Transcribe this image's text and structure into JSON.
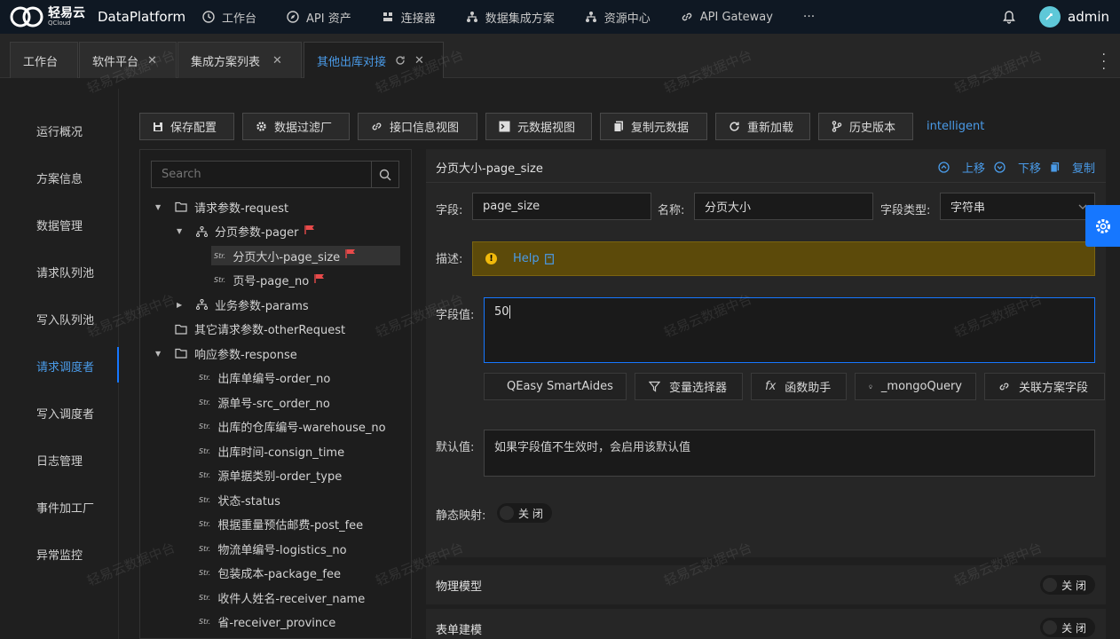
{
  "topnav": {
    "logo_cn": "轻易云",
    "logo_en": "QCloud",
    "app_name": "DataPlatform",
    "items": [
      {
        "label": "工作台",
        "icon": "clock-icon"
      },
      {
        "label": "API 资产",
        "icon": "compass-icon"
      },
      {
        "label": "连接器",
        "icon": "connector-icon"
      },
      {
        "label": "数据集成方案",
        "icon": "sitemap-icon"
      },
      {
        "label": "资源中心",
        "icon": "sitemap-icon"
      },
      {
        "label": "API Gateway",
        "icon": "link-icon"
      }
    ],
    "more": "···",
    "username": "admin"
  },
  "tabs": [
    {
      "label": "工作台"
    },
    {
      "label": "软件平台"
    },
    {
      "label": "集成方案列表"
    },
    {
      "label": "其他出库对接"
    }
  ],
  "sidebar": {
    "items": [
      "运行概况",
      "方案信息",
      "数据管理",
      "请求队列池",
      "写入队列池",
      "请求调度者",
      "写入调度者",
      "日志管理",
      "事件加工厂",
      "异常监控"
    ],
    "active_index": 5
  },
  "toolbar": {
    "buttons": [
      "保存配置",
      "数据过滤厂",
      "接口信息视图",
      "元数据视图",
      "复制元数据",
      "重新加载",
      "历史版本"
    ],
    "link": "intelligent"
  },
  "tree": {
    "search_placeholder": "Search",
    "nodes": [
      {
        "label": "请求参数-request",
        "type": "folder",
        "expanded": true
      },
      {
        "label": "分页参数-pager",
        "type": "object",
        "expanded": true,
        "flag": true
      },
      {
        "label": "分页大小-page_size",
        "type": "string",
        "flag": true,
        "selected": true
      },
      {
        "label": "页号-page_no",
        "type": "string",
        "flag": true
      },
      {
        "label": "业务参数-params",
        "type": "object",
        "expanded": false
      },
      {
        "label": "其它请求参数-otherRequest",
        "type": "folder"
      },
      {
        "label": "响应参数-response",
        "type": "folder",
        "expanded": true
      },
      {
        "label": "出库单编号-order_no",
        "type": "string"
      },
      {
        "label": "源单号-src_order_no",
        "type": "string"
      },
      {
        "label": "出库的仓库编号-warehouse_no",
        "type": "string"
      },
      {
        "label": "出库时间-consign_time",
        "type": "string"
      },
      {
        "label": "源单据类别-order_type",
        "type": "string"
      },
      {
        "label": "状态-status",
        "type": "string"
      },
      {
        "label": "根据重量预估邮费-post_fee",
        "type": "string"
      },
      {
        "label": "物流单编号-logistics_no",
        "type": "string"
      },
      {
        "label": "包装成本-package_fee",
        "type": "string"
      },
      {
        "label": "收件人姓名-receiver_name",
        "type": "string"
      },
      {
        "label": "省-receiver_province",
        "type": "string"
      }
    ],
    "string_tag": "Str."
  },
  "form": {
    "title": "分页大小-page_size",
    "actions": {
      "up": "上移",
      "down": "下移",
      "copy": "复制"
    },
    "field_label": "字段:",
    "field_value": "page_size",
    "name_label": "名称:",
    "name_value": "分页大小",
    "type_label": "字段类型:",
    "type_value": "字符串",
    "desc_label": "描述:",
    "help": "Help",
    "value_label": "字段值:",
    "value": "50",
    "aides": [
      "QEasy SmartAides",
      "变量选择器",
      "函数助手",
      "_mongoQuery",
      "关联方案字段"
    ],
    "fx": "fx",
    "default_label": "默认值:",
    "default_placeholder": "如果字段值不生效时，会启用该默认值",
    "static_label": "静态映射:",
    "static_toggle": "关 闭"
  },
  "sections": [
    {
      "title": "物理模型",
      "toggle": "关 闭"
    },
    {
      "title": "表单建模",
      "toggle": "关 闭"
    }
  ],
  "watermark": "轻易云数据中台",
  "colors": {
    "accent": "#1677ff",
    "link": "#4a9be8",
    "topbar": "#0f1823",
    "flag": "#e84a4a",
    "help_bg": "#5c4a0a"
  }
}
